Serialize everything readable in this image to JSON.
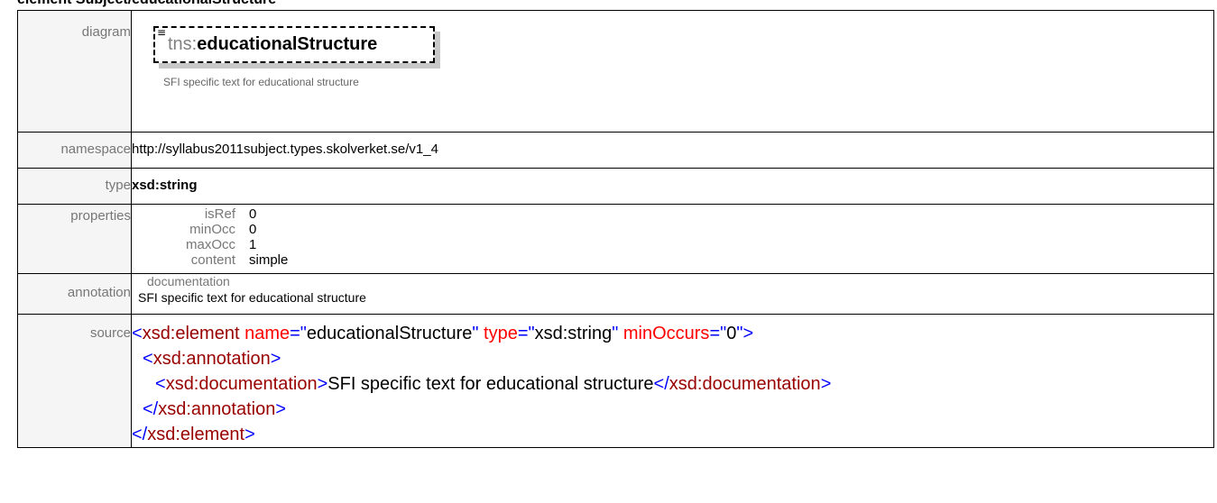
{
  "page_title": "element Subject/educationalStructure",
  "labels": {
    "diagram": "diagram",
    "namespace": "namespace",
    "type": "type",
    "properties": "properties",
    "annotation": "annotation",
    "source": "source"
  },
  "diagram": {
    "prefix": "tns:",
    "name": "educationalStructure",
    "note": "SFI specific text for educational structure",
    "icon": "list-icon"
  },
  "namespace": "http://syllabus2011subject.types.skolverket.se/v1_4",
  "type": "xsd:string",
  "properties": [
    {
      "key": "isRef",
      "value": "0"
    },
    {
      "key": "minOcc",
      "value": "0"
    },
    {
      "key": "maxOcc",
      "value": "1"
    },
    {
      "key": "content",
      "value": "simple"
    }
  ],
  "annotation": {
    "heading": "documentation",
    "text": "SFI specific text for educational structure"
  },
  "source": {
    "l1": {
      "open": "<",
      "tag": "xsd:element",
      "attr1_name": " name",
      "eq1": "=\"",
      "attr1_val": "educationalStructure",
      "q1": "\"",
      "attr2_name": " type",
      "eq2": "=\"",
      "attr2_val": "xsd:string",
      "q2": "\"",
      "attr3_name": " minOccurs",
      "eq3": "=\"",
      "attr3_val": "0",
      "close": "\">"
    },
    "l2": {
      "open": "<",
      "tag": "xsd:annotation",
      "close": ">"
    },
    "l3": {
      "open": "<",
      "tag": "xsd:documentation",
      "close": ">",
      "text": "SFI specific text for educational structure",
      "end_open": "</",
      "end_tag": "xsd:documentation",
      "end_close": ">"
    },
    "l4": {
      "open": "</",
      "tag": "xsd:annotation",
      "close": ">"
    },
    "l5": {
      "open": "</",
      "tag": "xsd:element",
      "close": ">"
    }
  },
  "colors": {
    "tag": "#990000",
    "punct": "#0000ff",
    "attr": "#ff0000",
    "label_bg": "#f5f5f5",
    "label_text": "#777777"
  }
}
